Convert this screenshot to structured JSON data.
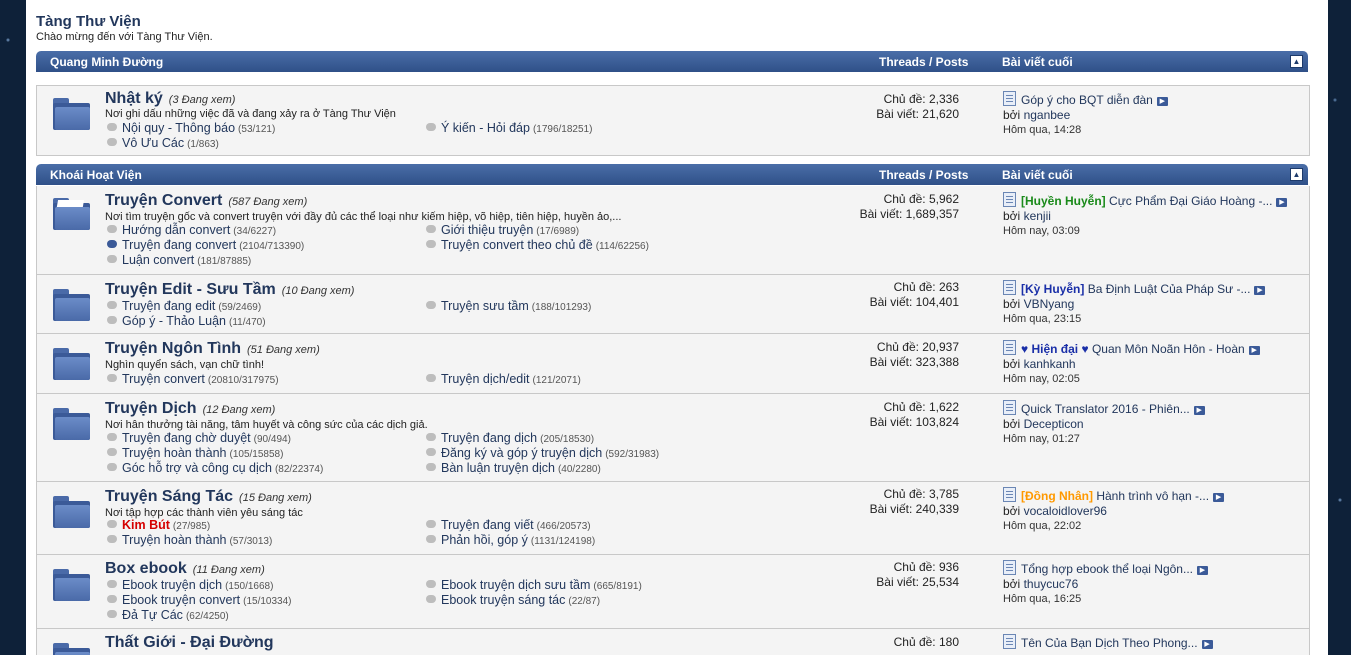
{
  "header": {
    "title": "Tàng Thư Viện",
    "subtitle": "Chào mừng đến với Tàng Thư Viện."
  },
  "categories": [
    {
      "name": "Quang Minh Đường",
      "threads_posts": "Threads / Posts",
      "last_post": "Bài viết cuối"
    },
    {
      "name": "Khoái Hoạt Viện",
      "threads_posts": "Threads / Posts",
      "last_post": "Bài viết cuối"
    }
  ],
  "collapse_icon": "▲",
  "forums": [
    {
      "title": "Nhật ký",
      "viewing": "(3 Đang xem)",
      "desc": "Nơi ghi dấu những việc đã và đang xảy ra ở Tàng Thư Viện",
      "subs": [
        {
          "label": "Nội quy - Thông báo",
          "count": "(53/121)"
        },
        {
          "label": "Ý kiến - Hỏi đáp",
          "count": "(1796/18251)"
        },
        {
          "label": "Vô Ưu Các",
          "count": "(1/863)"
        }
      ],
      "threads": "Chủ đề: 2,336",
      "posts": "Bài viết: 21,620",
      "last": {
        "prefix": "",
        "title": "Góp ý cho BQT diễn đàn",
        "by": "bởi",
        "user": "nganbee",
        "time": "Hôm qua, 14:28"
      }
    },
    {
      "title": "Truyện Convert",
      "viewing": "(587 Đang xem)",
      "desc": "Nơi tìm truyện gốc và convert truyện với đầy đủ các thể loại như kiếm hiệp, võ hiệp, tiên hiệp, huyền ảo,...",
      "subs": [
        {
          "label": "Hướng dẫn convert",
          "count": "(34/6227)"
        },
        {
          "label": "Giới thiệu truyện",
          "count": "(17/6989)"
        },
        {
          "label": "Truyện đang convert",
          "count": "(2104/713390)"
        },
        {
          "label": "Truyện convert theo chủ đề",
          "count": "(114/62256)"
        },
        {
          "label": "Luận convert",
          "count": "(181/87885)"
        }
      ],
      "threads": "Chủ đề: 5,962",
      "posts": "Bài viết: 1,689,357",
      "last": {
        "prefix": "[Huyền Huyễn]",
        "title": "Cực Phẩm Đại Giáo Hoàng -...",
        "by": "bởi",
        "user": "kenjii",
        "time": "Hôm nay, 03:09"
      }
    },
    {
      "title": "Truyện Edit - Sưu Tầm",
      "viewing": "(10 Đang xem)",
      "desc": "",
      "subs": [
        {
          "label": "Truyện đang edit",
          "count": "(59/2469)"
        },
        {
          "label": "Truyện sưu tầm",
          "count": "(188/101293)"
        },
        {
          "label": "Góp ý - Thảo Luận",
          "count": "(11/470)"
        }
      ],
      "threads": "Chủ đề: 263",
      "posts": "Bài viết: 104,401",
      "last": {
        "prefix": "[Kỳ Huyễn]",
        "title": "Ba Định Luật Của Pháp Sư -...",
        "by": "bởi",
        "user": "VBNyang",
        "time": "Hôm qua, 23:15"
      }
    },
    {
      "title": "Truyện Ngôn Tình",
      "viewing": "(51 Đang xem)",
      "desc": "Nghìn quyển sách, vạn chữ tình!",
      "subs": [
        {
          "label": "Truyện convert",
          "count": "(20810/317975)"
        },
        {
          "label": "Truyện dịch/edit",
          "count": "(121/2071)"
        }
      ],
      "threads": "Chủ đề: 20,937",
      "posts": "Bài viết: 323,388",
      "last": {
        "prefix": "♥ Hiện đại ♥",
        "title": "Quan Môn Noãn Hôn - Hoàn",
        "by": "bởi",
        "user": "kanhkanh",
        "time": "Hôm nay, 02:05"
      }
    },
    {
      "title": "Truyện Dịch",
      "viewing": "(12 Đang xem)",
      "desc": "Nơi hân thưởng tài năng, tâm huyết và công sức của các dịch giả.",
      "subs": [
        {
          "label": "Truyện đang chờ duyệt",
          "count": "(90/494)"
        },
        {
          "label": "Truyện đang dịch",
          "count": "(205/18530)"
        },
        {
          "label": "Truyện hoàn thành",
          "count": "(105/15858)"
        },
        {
          "label": "Đăng ký và góp ý truyện dịch",
          "count": "(592/31983)"
        },
        {
          "label": "Góc hỗ trợ và công cụ dịch",
          "count": "(82/22374)"
        },
        {
          "label": "Bàn luận truyện dịch",
          "count": "(40/2280)"
        }
      ],
      "threads": "Chủ đề: 1,622",
      "posts": "Bài viết: 103,824",
      "last": {
        "prefix": "",
        "title": "Quick Translator 2016 - Phiên...",
        "by": "bởi",
        "user": "Decepticon",
        "time": "Hôm nay, 01:27"
      }
    },
    {
      "title": "Truyện Sáng Tác",
      "viewing": "(15 Đang xem)",
      "desc": "Nơi tập hợp các thành viên yêu sáng tác",
      "subs": [
        {
          "label": "Kim Bút",
          "count": "(27/985)"
        },
        {
          "label": "Truyện đang viết",
          "count": "(466/20573)"
        },
        {
          "label": "Truyện hoàn thành",
          "count": "(57/3013)"
        },
        {
          "label": "Phản hồi, góp ý",
          "count": "(1131/124198)"
        }
      ],
      "threads": "Chủ đề: 3,785",
      "posts": "Bài viết: 240,339",
      "last": {
        "prefix": "[Đồng Nhân]",
        "title": "Hành trình vô hạn -...",
        "by": "bởi",
        "user": "vocaloidlover96",
        "time": "Hôm qua, 22:02"
      }
    },
    {
      "title": "Box ebook",
      "viewing": "(11 Đang xem)",
      "desc": "",
      "subs": [
        {
          "label": "Ebook truyện dịch",
          "count": "(150/1668)"
        },
        {
          "label": "Ebook truyện dịch sưu tầm",
          "count": "(665/8191)"
        },
        {
          "label": "Ebook truyện convert",
          "count": "(15/10334)"
        },
        {
          "label": "Ebook truyện sáng tác",
          "count": "(22/87)"
        },
        {
          "label": "Đả Tự Các",
          "count": "(62/4250)"
        }
      ],
      "threads": "Chủ đề: 936",
      "posts": "Bài viết: 25,534",
      "last": {
        "prefix": "",
        "title": "Tổng hợp ebook thể loại Ngôn...",
        "by": "bởi",
        "user": "thuycuc76",
        "time": "Hôm qua, 16:25"
      }
    },
    {
      "title": "Thất Giới - Đại Đường",
      "viewing": "",
      "desc": "",
      "subs": [],
      "threads": "Chủ đề: 180",
      "posts": "",
      "last": {
        "prefix": "",
        "title": "Tên Của Bạn Dịch Theo Phong...",
        "by": "",
        "user": "",
        "time": ""
      }
    }
  ],
  "colors": {
    "prefix_green": "#1a8a1a",
    "prefix_blue": "#1a2fa8",
    "prefix_orange": "#ff9900",
    "red": "#d50000"
  }
}
